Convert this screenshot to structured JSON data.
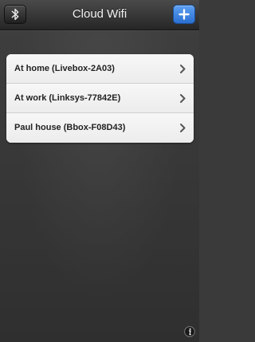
{
  "navbar": {
    "title": "Cloud Wifi",
    "left_icon": "bluetooth-icon",
    "right_icon": "plus-icon",
    "accent_color": "#2f7bdc"
  },
  "networks": [
    {
      "label": "At home (Livebox-2A03)"
    },
    {
      "label": "At work (Linksys-77842E)"
    },
    {
      "label": "Paul house (Bbox-F08D43)"
    }
  ],
  "footer": {
    "info_icon": "info-icon"
  }
}
